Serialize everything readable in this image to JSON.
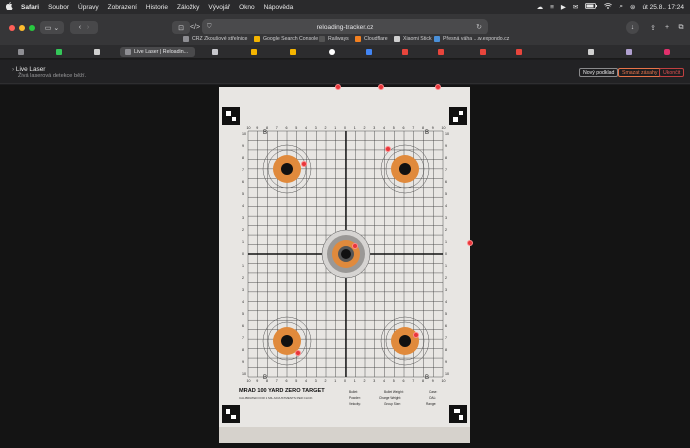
{
  "menubar": {
    "app": "Safari",
    "items": [
      "Soubor",
      "Úpravy",
      "Zobrazení",
      "Historie",
      "Záložky",
      "Vývojář",
      "Okno",
      "Nápověda"
    ],
    "datetime": "út 25.8.. 17:24"
  },
  "toolbar": {
    "url": "reloading-tracker.cz"
  },
  "bookmarks": [
    {
      "label": "CRZ Zkoušové střelnice",
      "color": "#8e8e93"
    },
    {
      "label": "Google Search Console",
      "color": "#f4b400"
    },
    {
      "label": "Railways",
      "color": "#333333"
    },
    {
      "label": "Cloudflare",
      "color": "#f38020"
    },
    {
      "label": "Xiaomi Stick",
      "color": "#d0d0d0"
    },
    {
      "label": "Přesná váha ...w.expondo.cz",
      "color": "#4a90d9"
    }
  ],
  "tabs": {
    "active_label": "Live Laser | Reloadin...",
    "icons": [
      "#8e8e93",
      "#34c759",
      "#d0d0d0",
      "#8e8e93",
      "#f4b400",
      "#f4b400",
      "#4285f4",
      "#ffffff",
      "#e8453c",
      "#e8453c",
      "#e8453c",
      "#e8453c",
      "#d0d0d0",
      "#b0a0d0",
      "#e1306c"
    ]
  },
  "header": {
    "title": "Live Laser",
    "subtitle": "Živá laserová detekce běží.",
    "buttons": {
      "new_background": "Nový podklad",
      "clear_hits": "Smazat zásahy",
      "end": "Ukončit"
    }
  },
  "target": {
    "title": "MRAD 100 YARD ZERO TARGET",
    "line1": "CALIBRATED FOR 1 MIL ADJUSTMENTS PER CLICK",
    "fields": [
      "Bullet:",
      "Bullet Weight:",
      "Case:",
      "Powder:",
      "Charge Weight:",
      "OAL:",
      "Velocity:",
      "Group Size:",
      "Range:"
    ],
    "grid_numbers": [
      "10",
      "9",
      "8",
      "7",
      "6",
      "5",
      "4",
      "3",
      "2",
      "1",
      "0",
      "1",
      "2",
      "3",
      "4",
      "5",
      "6",
      "7",
      "8",
      "9",
      "10"
    ],
    "corner_labels": [
      "B",
      "B",
      "B",
      "B"
    ]
  },
  "colors": {
    "hit": "#e8363a",
    "orange_ring": "#e08a3c",
    "accent_red_button": "#e0553d"
  }
}
